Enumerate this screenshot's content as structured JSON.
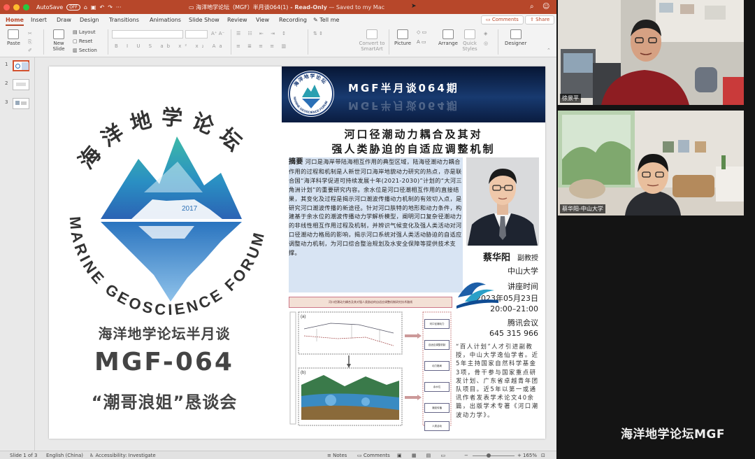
{
  "window": {
    "title": "海洋地学论坛（MGF）半月谈064(1)",
    "suffix": " - Read-Only",
    "saved": " — Saved to my Mac",
    "autosave_label": "AutoSave",
    "autosave_state": "OFF"
  },
  "tabs": [
    "Home",
    "Insert",
    "Draw",
    "Design",
    "Transitions",
    "Animations",
    "Slide Show",
    "Review",
    "View",
    "Recording",
    "Tell me"
  ],
  "ribbon_buttons": {
    "comments": "Comments",
    "share": "Share"
  },
  "ribbon": {
    "paste": "Paste",
    "new_slide": "New Slide",
    "layout": "Layout",
    "reset": "Reset",
    "section": "Section",
    "convert": "Convert to SmartArt",
    "picture": "Picture",
    "arrange": "Arrange",
    "quick_styles": "Quick Styles",
    "designer": "Designer"
  },
  "thumbnails": [
    "1",
    "2",
    "3"
  ],
  "status": {
    "slide": "Slide 1 of 3",
    "language": "English (China)",
    "accessibility": "Accessibility: Investigate",
    "notes": "Notes",
    "comments": "Comments",
    "zoom": "165%"
  },
  "slide": {
    "logo_top": "海洋地学论坛",
    "logo_ring": "MARINE GEOSCIENCE FORUM",
    "logo_year": "2017",
    "left_line1": "海洋地学论坛半月谈",
    "left_line2": "MGF-064",
    "left_line3": "“潮哥浪姐”恳谈会"
  },
  "poster": {
    "banner_title": "MGF半月谈064期",
    "badge_top": "海洋地学论坛",
    "badge_ring": "MARINE GEOSCIENCE FORUM",
    "title_line1": "河口径潮动力耦合及其对",
    "title_line2": "强人类胁迫的自适应调整机制",
    "abstract_label": "摘要",
    "abstract_text": "河口是海岸带陆海相互作用的典型区域，陆海径潮动力耦合作用的过程和机制是人新世河口海岸地貌动力研究的热点，亦是联合国“海洋科学促进可持续发展十年(2021-2030)”计划的“大河三角洲计划”的重要研究内容。余水位是河口径潮相互作用的直接结果，其变化及过程是揭示河口潮波传播动力机制的有效切入点，是研究河口潮波传播的新途径。针对河口肤特的地形和动力条件，构建基于余水位的潮波传播动力学解析模型，阐明河口复杂径潮动力的非线性相互作用过程及机制，并辨识气候变化及强人类活动对河口径潮动力格局的影响，揭示河口系统对强人类活动胁迫的自适应调整动力机制，为河口综合整治规划及水安全保障等提供技术支撑。",
    "speaker_name": "蔡华阳",
    "speaker_title": "副教授",
    "affiliation": "中山大学",
    "time_label": "讲座时间",
    "date": "2023年05月23日",
    "time": "20:00–21:00",
    "meeting_label": "腾讯会议",
    "meeting_id": "645 315 966",
    "bio": "“百人计划”人才引进副教授，中山大学逸仙学者。近5年主持国家自然科学基金3项，骨干参与国家重点研发计划、广东省卓越青年团队项目。近5年以第一或通讯作者发表学术论文40余篇，出版学术专著《河口潮波动力学》。",
    "fig_caption": "河口径潮动力耦合及其对强人类胁迫的自适应调整机制研究技术路线",
    "fig_box_a": "(a)",
    "fig_box_b": "(b)",
    "fig_boxes": [
      "河口径潮动力",
      "自适应调整机制",
      "动力格局",
      "余水位",
      "潮波传播",
      "人类活动"
    ]
  },
  "video": {
    "top_name": "徐景平",
    "bottom_name": "蔡华阳-中山大学",
    "watermark": "海洋地学论坛MGF"
  },
  "colors": {
    "accent": "#b7472a",
    "teal": "#2aa9a0",
    "blue": "#2a6fb5",
    "banner": "#0b1f4a",
    "abstract_bg": "#d8e4f3"
  }
}
